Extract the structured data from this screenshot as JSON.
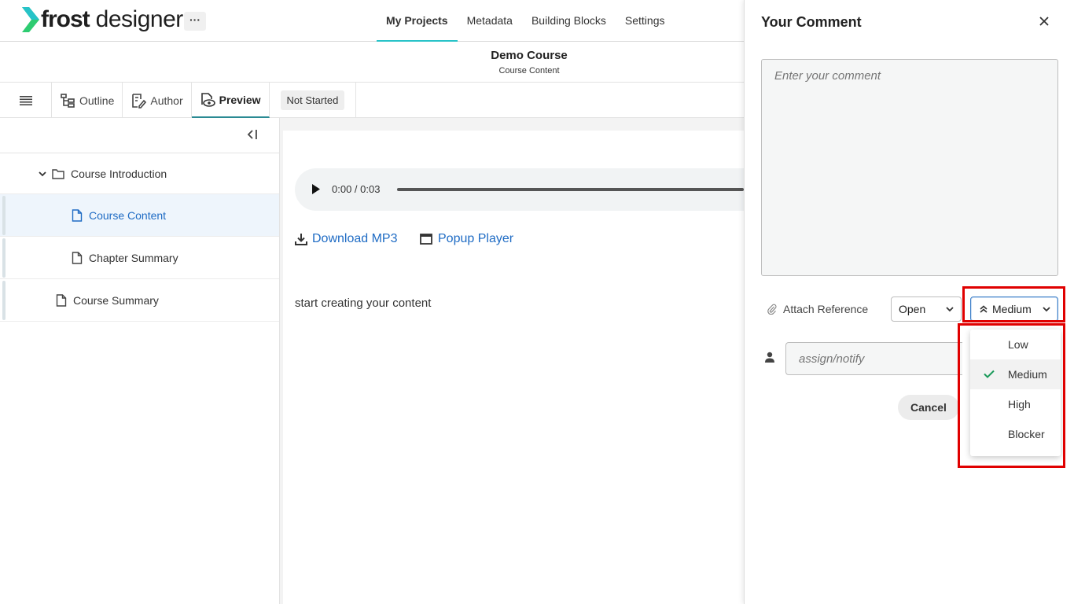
{
  "brand": {
    "name_bold": "frost",
    "name_light": "designer",
    "accent": "#2ecc71"
  },
  "topnav": {
    "more": "···",
    "items": [
      {
        "label": "My Projects",
        "active": true
      },
      {
        "label": "Metadata"
      },
      {
        "label": "Building Blocks"
      },
      {
        "label": "Settings"
      }
    ]
  },
  "course": {
    "title": "Demo Course",
    "subtitle": "Course Content"
  },
  "toolbar": {
    "tabs": [
      {
        "label": "Outline",
        "icon": "outline-icon"
      },
      {
        "label": "Author",
        "icon": "author-icon"
      },
      {
        "label": "Preview",
        "icon": "preview-icon",
        "active": true
      }
    ],
    "status": "Not Started"
  },
  "sidebar": {
    "items": [
      {
        "label": "Course Introduction",
        "type": "folder",
        "expanded": true
      },
      {
        "label": "Course Content",
        "type": "page",
        "selected": true
      },
      {
        "label": "Chapter Summary",
        "type": "page"
      },
      {
        "label": "Course Summary",
        "type": "page"
      }
    ]
  },
  "content": {
    "audio": {
      "time": "0:00 / 0:03"
    },
    "download_label": "Download MP3",
    "popup_label": "Popup Player",
    "body_text": "start creating your content"
  },
  "comment_panel": {
    "title": "Your Comment",
    "comment_placeholder": "Enter your comment",
    "attach_label": "Attach Reference",
    "status_value": "Open",
    "priority_value": "Medium",
    "assign_placeholder": "assign/notify",
    "cancel_label": "Cancel",
    "priority_options": [
      {
        "label": "Low"
      },
      {
        "label": "Medium",
        "selected": true
      },
      {
        "label": "High"
      },
      {
        "label": "Blocker"
      }
    ]
  }
}
